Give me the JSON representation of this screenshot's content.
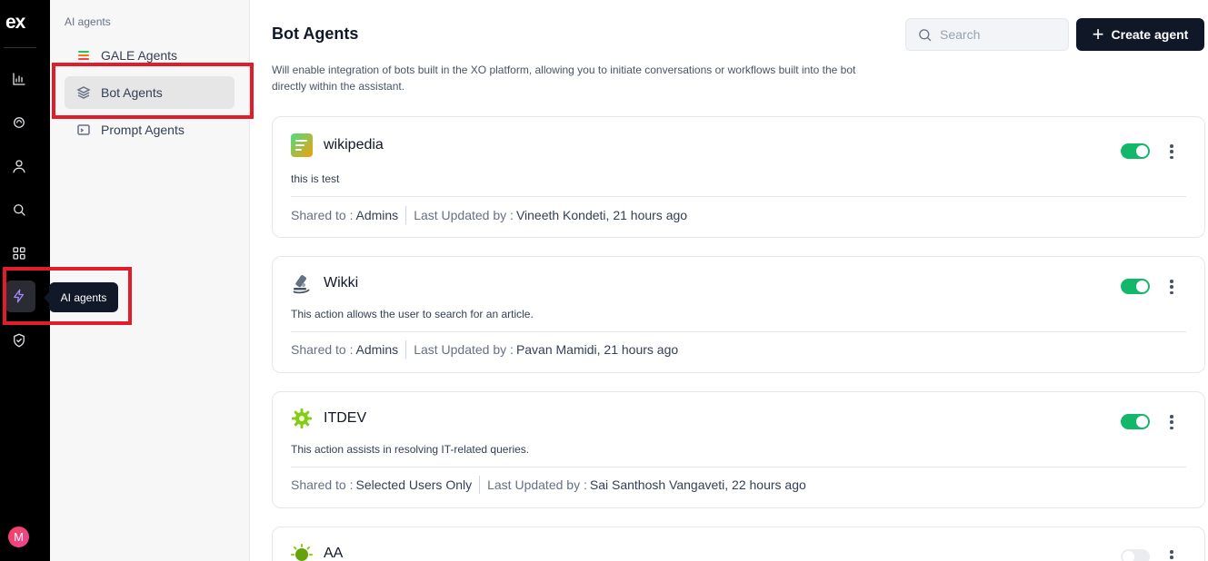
{
  "rail": {
    "logo": "ex",
    "icons": [
      "analytics-icon",
      "circle-icon",
      "user-icon",
      "search-icon",
      "grid-icon",
      "lightning-icon",
      "shield-icon"
    ],
    "avatar": "M",
    "active_tooltip": "AI agents"
  },
  "sidenav": {
    "section_title": "AI agents",
    "items": [
      {
        "label": "GALE Agents",
        "icon": "gale-icon"
      },
      {
        "label": "Bot Agents",
        "icon": "layers-icon",
        "active": true
      },
      {
        "label": "Prompt Agents",
        "icon": "terminal-icon"
      }
    ]
  },
  "header": {
    "title": "Bot Agents",
    "description": "Will enable integration of bots built in the XO platform, allowing you to initiate conversations or workflows built into the bot directly within the assistant.",
    "search_placeholder": "Search",
    "create_label": "Create agent"
  },
  "labels": {
    "shared_to": "Shared to :",
    "last_updated_by": "Last Updated by :"
  },
  "agents": [
    {
      "name": "wikipedia",
      "description": "this is test",
      "shared_to": "Admins",
      "updated": "Vineeth Kondeti, 21 hours ago",
      "enabled": true,
      "icon": "document-icon"
    },
    {
      "name": "Wikki",
      "description": "This action allows the user to search for an article.",
      "shared_to": "Admins",
      "updated": "Pavan Mamidi, 21 hours ago",
      "enabled": true,
      "icon": "microscope-icon"
    },
    {
      "name": "ITDEV",
      "description": "This action assists in resolving IT-related queries.",
      "shared_to": "Selected Users Only",
      "updated": "Sai Santhosh Vangaveti, 22 hours ago",
      "enabled": true,
      "icon": "gear-icon"
    },
    {
      "name": "AA",
      "enabled": false,
      "icon": "sun-icon"
    }
  ],
  "colors": {
    "toggle_on": "#12b76a",
    "highlight": "#e11d2b",
    "primary_button": "#101828"
  }
}
